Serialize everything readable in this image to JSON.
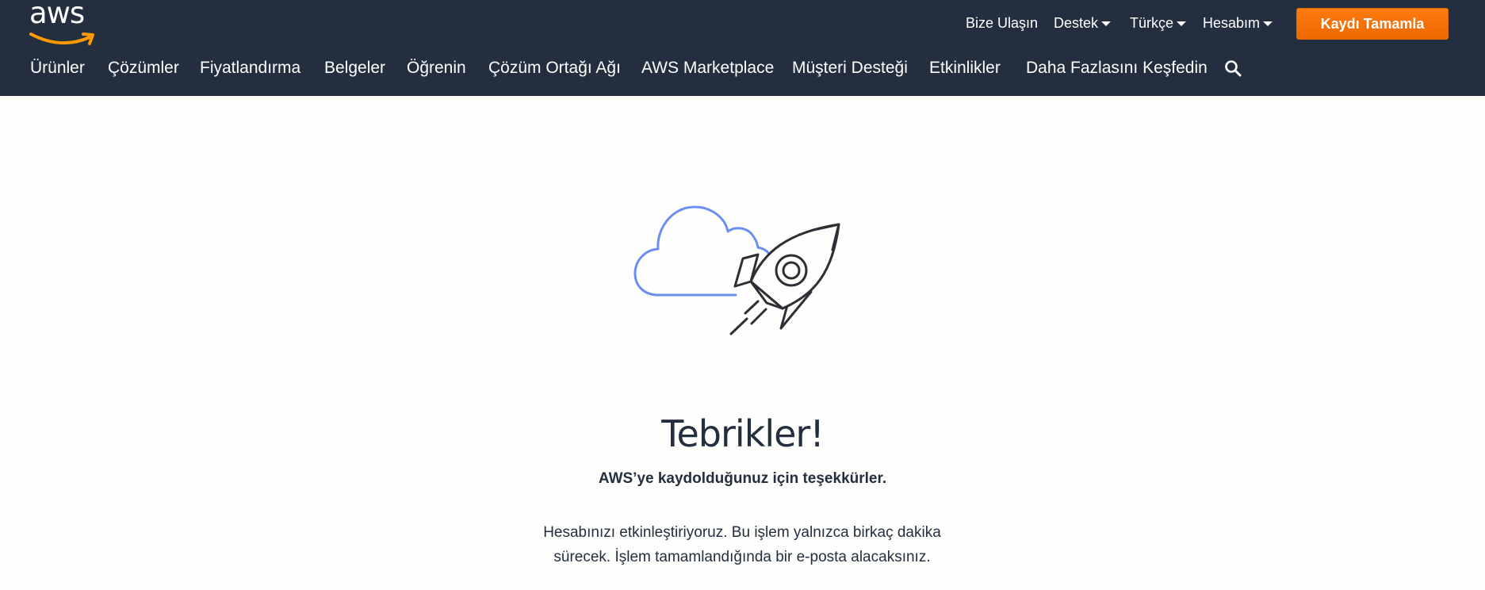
{
  "brand": {
    "logo_text": "aws",
    "accent": "#ff9900",
    "nav_bg": "#232f3e",
    "cta_color": "#ec7211"
  },
  "utility_nav": {
    "contact": "Bize Ulaşın",
    "support": "Destek",
    "language": "Türkçe",
    "account": "Hesabım"
  },
  "cta": {
    "label": "Kaydı Tamamla"
  },
  "main_nav": {
    "items": [
      "Ürünler",
      "Çözümler",
      "Fiyatlandırma",
      "Belgeler",
      "Öğrenin",
      "Çözüm Ortağı Ağı",
      "AWS Marketplace",
      "Müşteri Desteği",
      "Etkinlikler",
      "Daha Fazlasını Keşfedin"
    ],
    "search_icon": "search-icon"
  },
  "hero": {
    "illustration": "cloud-rocket-illustration",
    "title": "Tebrikler!",
    "subtitle": "AWS’ye kaydolduğunuz için teşekkürler.",
    "body_line1": "Hesabınızı etkinleştiriyoruz. Bu işlem yalnızca birkaç dakika",
    "body_line2": "sürecek. İşlem tamamlandığında bir e-posta alacaksınız."
  }
}
